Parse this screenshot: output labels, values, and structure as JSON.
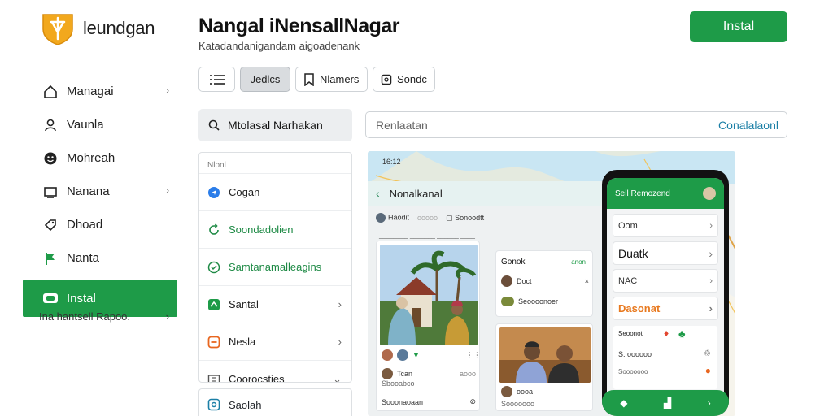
{
  "brand": {
    "name": "leundgan"
  },
  "sidebar": {
    "items": [
      {
        "label": "Managai",
        "icon": "home-icon",
        "chevron": "›"
      },
      {
        "label": "Vaunla",
        "icon": "user-icon"
      },
      {
        "label": "Mohreah",
        "icon": "emoji-icon"
      },
      {
        "label": "Nanana",
        "icon": "tv-icon",
        "chevron": "›"
      },
      {
        "label": "Dhoad",
        "icon": "tag-icon"
      },
      {
        "label": "Nanta",
        "icon": "flag-icon"
      },
      {
        "label": "Instal",
        "icon": "install-icon",
        "active": true
      }
    ],
    "footer": {
      "label": "Ina hantsell Rapoo.",
      "chevron": "›"
    }
  },
  "header": {
    "title": "Nangal iNensallNagar",
    "subtitle": "Katadandanigandam aigoadenank",
    "install_label": "Instal"
  },
  "toolbar": {
    "buttons": [
      {
        "label": "",
        "icon": "list-icon"
      },
      {
        "label": "Jedlcs",
        "selected": true
      },
      {
        "label": "Nlamers",
        "icon": "bookmark-icon"
      },
      {
        "label": "Sondc",
        "icon": "square-icon"
      }
    ]
  },
  "search": {
    "label": "Mtolasal Narhakan"
  },
  "input": {
    "placeholder": "Renlaatan",
    "link": "Conalalaonl"
  },
  "list": {
    "heading": "Nlonl",
    "items": [
      {
        "label": "Cogan",
        "icon": "location-icon"
      },
      {
        "label": "Soondadolien",
        "icon": "refresh-icon",
        "green": true
      },
      {
        "label": "Samtanamalleagins",
        "icon": "check-circle-icon",
        "green": true
      },
      {
        "label": "Santal",
        "icon": "green-box-icon",
        "chevron": "›"
      },
      {
        "label": "Nesla",
        "icon": "orange-box-icon",
        "chevron": "›"
      },
      {
        "label": "Coorocsties",
        "icon": "grid-icon",
        "chevron": "⌄"
      }
    ],
    "extra": {
      "label": "Saolah",
      "icon": "shield-icon"
    }
  },
  "preview": {
    "map_time": "16:12",
    "header_title": "Nonalkanal",
    "chips": [
      "Haodit",
      "ooooo",
      "Sonoodtt"
    ],
    "small_caption": "________ _______ ______ ____",
    "card1": {
      "row1": "Tcan",
      "row2": "Sbooabco",
      "row2_meta": "aooo",
      "footer": "Sooonaoaan"
    },
    "card2": {
      "title": "Gonok",
      "tag": "anon",
      "row1": "Doct",
      "row2": "Seoooonoer"
    },
    "card3": {
      "row1": "oooa",
      "footer": "Sooooooo"
    }
  },
  "phone": {
    "title": "Sell Remozend",
    "rows": [
      "Oom",
      "Duatk",
      "NAC",
      "Dasonat"
    ],
    "section_title": "Seoonot",
    "section_row1": "S. oooooo",
    "section_row2": "Sooooooo",
    "accent": "#1e9b48"
  }
}
